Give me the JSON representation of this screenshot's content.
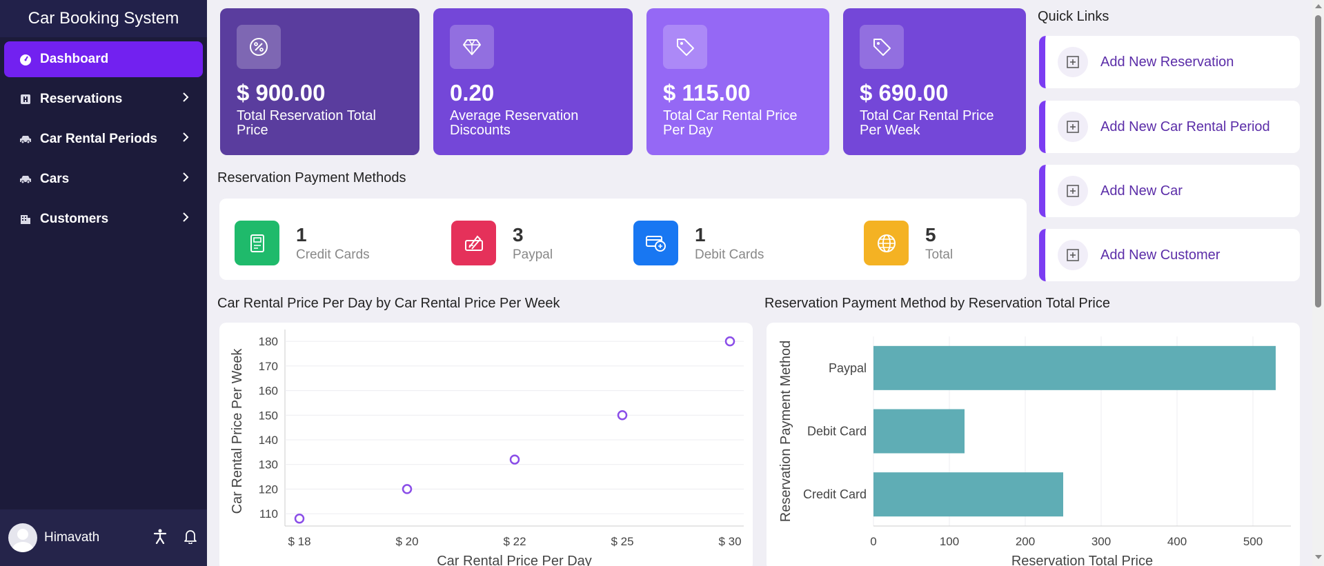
{
  "app": {
    "title": "Car Booking System"
  },
  "sidebar": {
    "items": [
      {
        "label": "Dashboard",
        "icon": "dashboard-icon",
        "active": true
      },
      {
        "label": "Reservations",
        "icon": "reservations-icon"
      },
      {
        "label": "Car Rental Periods",
        "icon": "car-icon"
      },
      {
        "label": "Cars",
        "icon": "car-icon"
      },
      {
        "label": "Customers",
        "icon": "customers-icon"
      }
    ]
  },
  "user": {
    "name": "Himavath"
  },
  "stats": [
    {
      "value": "$ 900.00",
      "label": "Total Reservation Total Price",
      "icon": "percent-badge-icon",
      "color": "#5a3d9e"
    },
    {
      "value": "0.20",
      "label": "Average Reservation Discounts",
      "icon": "diamond-icon",
      "color": "#7447d8"
    },
    {
      "value": "$ 115.00",
      "label": "Total Car Rental Price Per Day",
      "icon": "tag-icon",
      "color": "#9568f5"
    },
    {
      "value": "$ 690.00",
      "label": "Total Car Rental Price Per Week",
      "icon": "tag-icon",
      "color": "#7447d8"
    }
  ],
  "payment_methods": {
    "title": "Reservation Payment Methods",
    "items": [
      {
        "count": "1",
        "label": "Credit Cards",
        "icon": "card-icon",
        "color": "#1fba6b"
      },
      {
        "count": "3",
        "label": "Paypal",
        "icon": "paypal-icon",
        "color": "#e5315a"
      },
      {
        "count": "1",
        "label": "Debit Cards",
        "icon": "debit-card-icon",
        "color": "#1877f2"
      },
      {
        "count": "5",
        "label": "Total",
        "icon": "globe-icon",
        "color": "#f4b223"
      }
    ]
  },
  "quick_links": {
    "title": "Quick Links",
    "items": [
      {
        "label": "Add New Reservation"
      },
      {
        "label": "Add New Car Rental Period"
      },
      {
        "label": "Add New Car"
      },
      {
        "label": "Add New Customer"
      }
    ]
  },
  "chart_data": [
    {
      "type": "scatter",
      "title": "Car Rental Price Per Day by Car Rental Price Per Week",
      "xlabel": "Car Rental Price Per Day",
      "ylabel": "Car Rental Price Per Week",
      "categories": [
        "$ 18",
        "$ 20",
        "$ 22",
        "$ 25",
        "$ 30"
      ],
      "values": [
        108,
        120,
        132,
        150,
        180
      ],
      "yticks": [
        110,
        120,
        130,
        140,
        150,
        160,
        170,
        180
      ],
      "ylim": [
        105,
        182
      ],
      "grid": true,
      "color": "#8a4de8"
    },
    {
      "type": "bar",
      "orientation": "horizontal",
      "title": "Reservation Payment Method by Reservation Total Price",
      "xlabel": "Reservation Total Price",
      "ylabel": "Reservation Payment Method",
      "categories": [
        "Paypal",
        "Debit Card",
        "Credit Card"
      ],
      "values": [
        530,
        120,
        250
      ],
      "xticks": [
        0,
        100,
        200,
        300,
        400,
        500
      ],
      "xlim": [
        0,
        550
      ],
      "grid": true,
      "color": "#5fadb5"
    }
  ]
}
